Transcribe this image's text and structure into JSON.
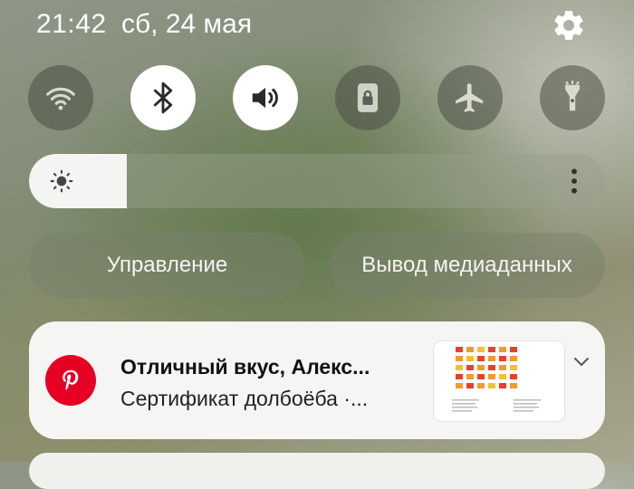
{
  "status_bar": {
    "time": "21:42",
    "date": "сб, 24 мая",
    "settings_icon": "gear-icon"
  },
  "quick_settings": [
    {
      "name": "wifi",
      "icon": "wifi-icon",
      "state": "off"
    },
    {
      "name": "bluetooth",
      "icon": "bluetooth-icon",
      "state": "on"
    },
    {
      "name": "sound",
      "icon": "speaker-icon",
      "state": "on"
    },
    {
      "name": "rotation-lock",
      "icon": "lock-rotation-icon",
      "state": "off"
    },
    {
      "name": "airplane",
      "icon": "airplane-icon",
      "state": "off"
    },
    {
      "name": "flashlight",
      "icon": "flashlight-icon",
      "state": "off"
    }
  ],
  "brightness": {
    "level": 0.17,
    "icon": "sun-icon",
    "more_icon": "more-vertical-icon"
  },
  "buttons": {
    "control_label": "Управление",
    "media_output_label": "Вывод медиаданных"
  },
  "notification": {
    "app_icon": "pinterest-icon",
    "title": "Отличный вкус, Алекс...",
    "body": "Сертификат долбоёба ·...",
    "expand_icon": "chevron-down-icon",
    "accent_color": "#e60023"
  }
}
